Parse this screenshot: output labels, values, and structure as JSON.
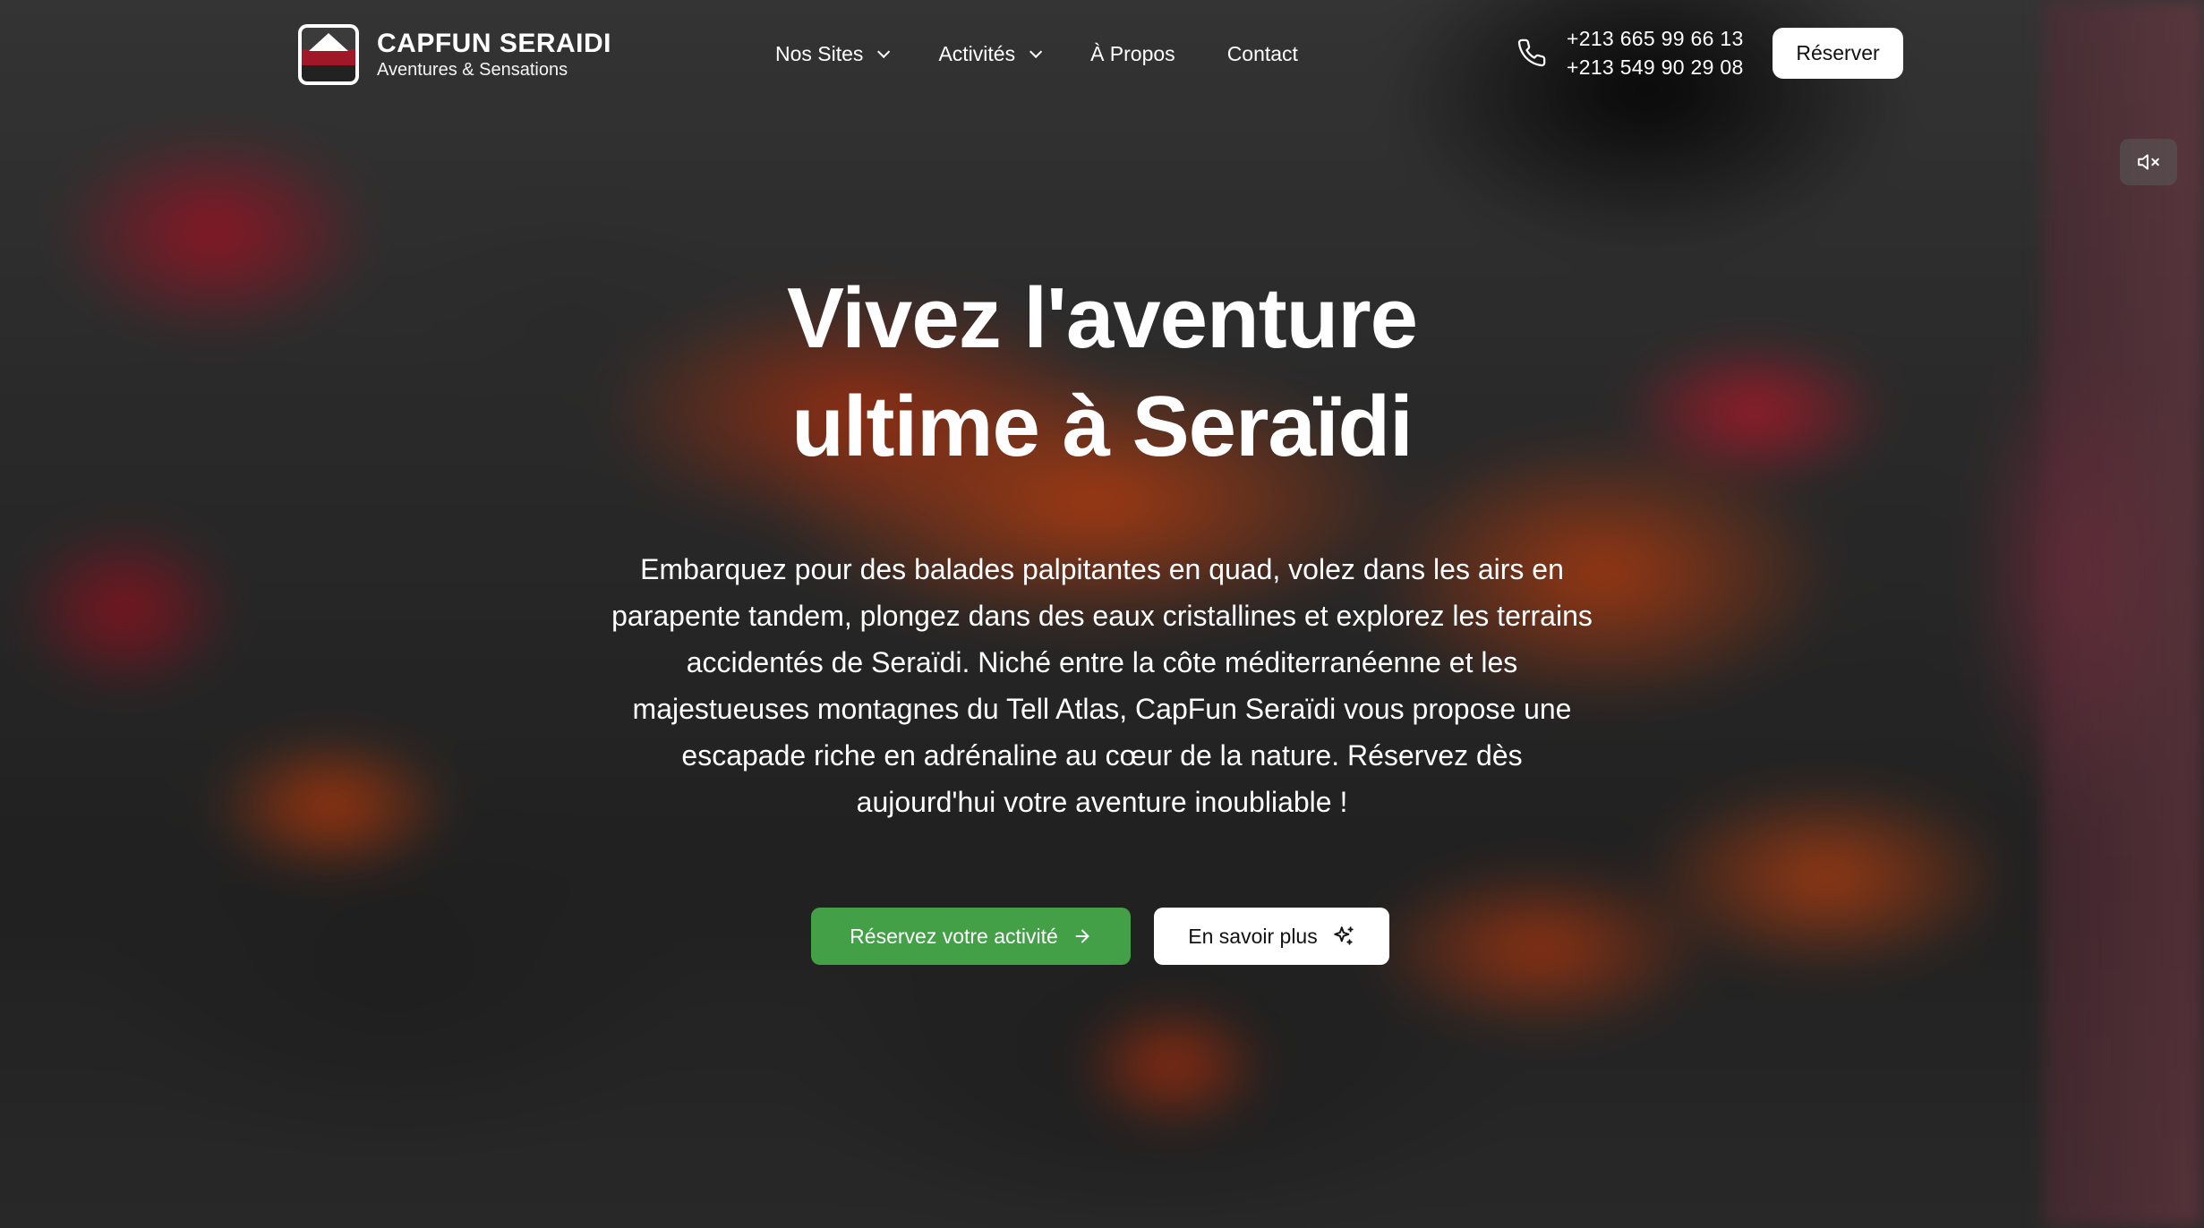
{
  "brand": {
    "name": "CAPFUN SERAIDI",
    "tagline": "Aventures & Sensations",
    "logo_text": "CAPFUN"
  },
  "nav": {
    "items": [
      {
        "label": "Nos Sites",
        "has_dropdown": true
      },
      {
        "label": "Activités",
        "has_dropdown": true
      },
      {
        "label": "À Propos",
        "has_dropdown": false
      },
      {
        "label": "Contact",
        "has_dropdown": false
      }
    ]
  },
  "contact": {
    "icon": "phone-icon",
    "phone_1": "+213 665 99 66 13",
    "phone_2": "+213 549 90 29 08"
  },
  "header": {
    "reserve_label": "Réserver"
  },
  "video": {
    "mute_icon": "volume-muted-icon"
  },
  "hero": {
    "headline_line1": "Vivez l'aventure",
    "headline_line2": "ultime à Seraïdi",
    "intro": "Embarquez pour des balades palpitantes en quad, volez dans les airs en parapente tandem, plongez dans des eaux cristallines et explorez les terrains accidentés de Seraïdi. Niché entre la côte méditerranéenne et les majestueuses montagnes du Tell Atlas, CapFun Seraïdi vous propose une escapade riche en adrénaline au cœur de la nature. Réservez dès aujourd'hui votre aventure inoubliable !",
    "cta_primary_label": "Réservez votre activité",
    "cta_primary_icon": "arrow-right-icon",
    "cta_secondary_label": "En savoir plus",
    "cta_secondary_icon": "sparkles-icon"
  },
  "colors": {
    "primary_green": "#43a047",
    "button_white": "#ffffff",
    "text_white": "#ffffff"
  }
}
